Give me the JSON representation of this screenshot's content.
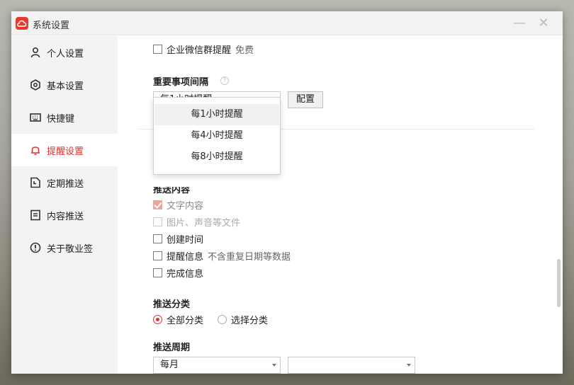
{
  "window": {
    "title": "系统设置",
    "minimize": "—",
    "close": "✕"
  },
  "sidebar": {
    "items": [
      {
        "label": "个人设置",
        "icon": "user-icon"
      },
      {
        "label": "基本设置",
        "icon": "settings-icon"
      },
      {
        "label": "快捷键",
        "icon": "keyboard-icon"
      },
      {
        "label": "提醒设置",
        "icon": "bell-icon",
        "active": true
      },
      {
        "label": "定期推送",
        "icon": "schedule-icon"
      },
      {
        "label": "内容推送",
        "icon": "content-icon"
      },
      {
        "label": "关于敬业签",
        "icon": "info-icon"
      }
    ]
  },
  "main": {
    "wecom_reminder": {
      "label": "企业微信群提醒",
      "note": "免费"
    },
    "important_interval": {
      "title": "重要事项间隔",
      "help": "?",
      "selected": "每1小时提醒",
      "config_button": "配置",
      "options": [
        "每1小时提醒",
        "每4小时提醒",
        "每8小时提醒"
      ]
    },
    "push_content": {
      "title": "推送内容",
      "items": [
        {
          "label": "文字内容",
          "state": "checked-disabled"
        },
        {
          "label": "图片、声音等文件",
          "state": "disabled"
        },
        {
          "label": "创建时间",
          "state": "unchecked"
        },
        {
          "label": "提醒信息",
          "note": "不含重复日期等数据",
          "state": "unchecked"
        },
        {
          "label": "完成信息",
          "state": "unchecked"
        }
      ]
    },
    "push_category": {
      "title": "推送分类",
      "options": [
        {
          "label": "全部分类",
          "selected": true
        },
        {
          "label": "选择分类",
          "selected": false
        }
      ]
    },
    "push_period": {
      "title": "推送周期",
      "selected": "每月",
      "second": ""
    }
  },
  "colors": {
    "accent": "#e0322b",
    "sidebar_bg": "#f3f3f3",
    "titlebar_bg": "#f2f2f2"
  }
}
